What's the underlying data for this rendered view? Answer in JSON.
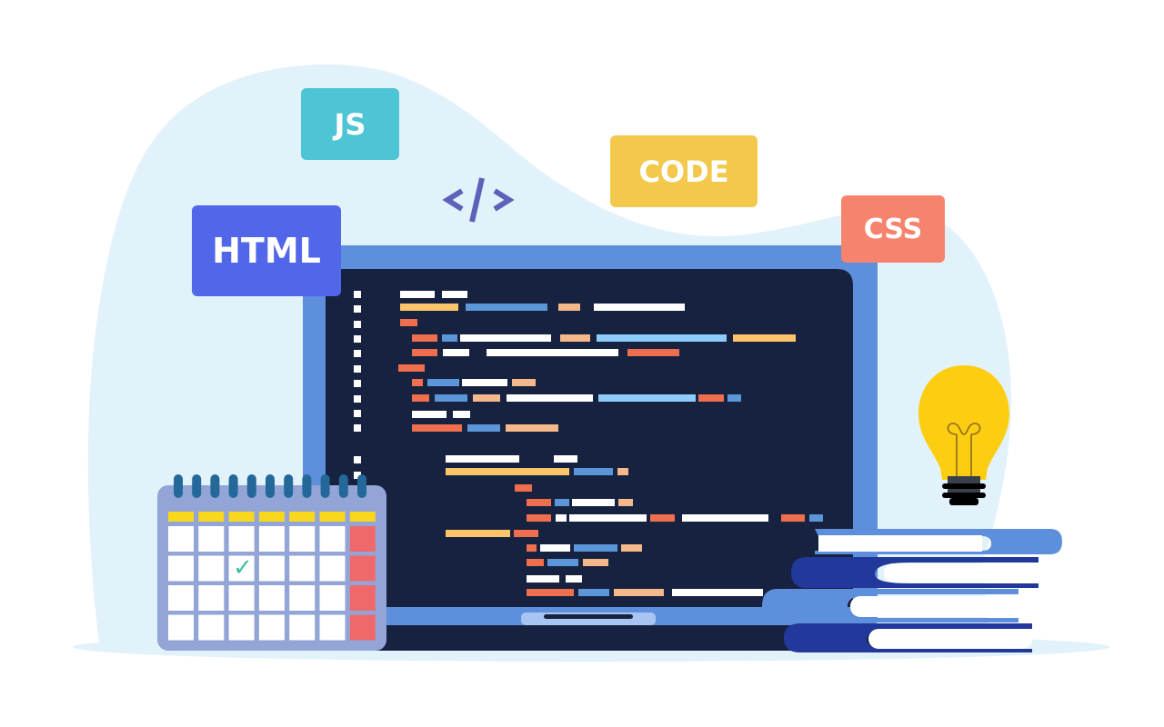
{
  "illustration": {
    "title": "Web development coding illustration",
    "badges": [
      {
        "id": "html",
        "label": "HTML",
        "color": "#5166e8"
      },
      {
        "id": "js",
        "label": "JS",
        "color": "#4ec5d4"
      },
      {
        "id": "code",
        "label": "CODE",
        "color": "#f2c94c"
      },
      {
        "id": "css",
        "label": "CSS",
        "color": "#f6836d"
      }
    ],
    "code_tag_symbol": "</>",
    "colors": {
      "background_blob": "#e2f2fb",
      "laptop_frame": "#5e8fdc",
      "screen": "#16223f",
      "calendar_body": "#93a5d6",
      "calendar_ring": "#24689a",
      "calendar_header": "#f9d71c",
      "calendar_weekend": "#f0696a",
      "check": "#3bbfa0",
      "bulb": "#fdcd12",
      "book_light": "#5e8fdc",
      "book_dark": "#22389a"
    },
    "calendar": {
      "columns": 7,
      "rows": 4,
      "checked_cell": {
        "row": 2,
        "col": 3
      },
      "check_icon": "✓"
    },
    "books_count": 4
  }
}
